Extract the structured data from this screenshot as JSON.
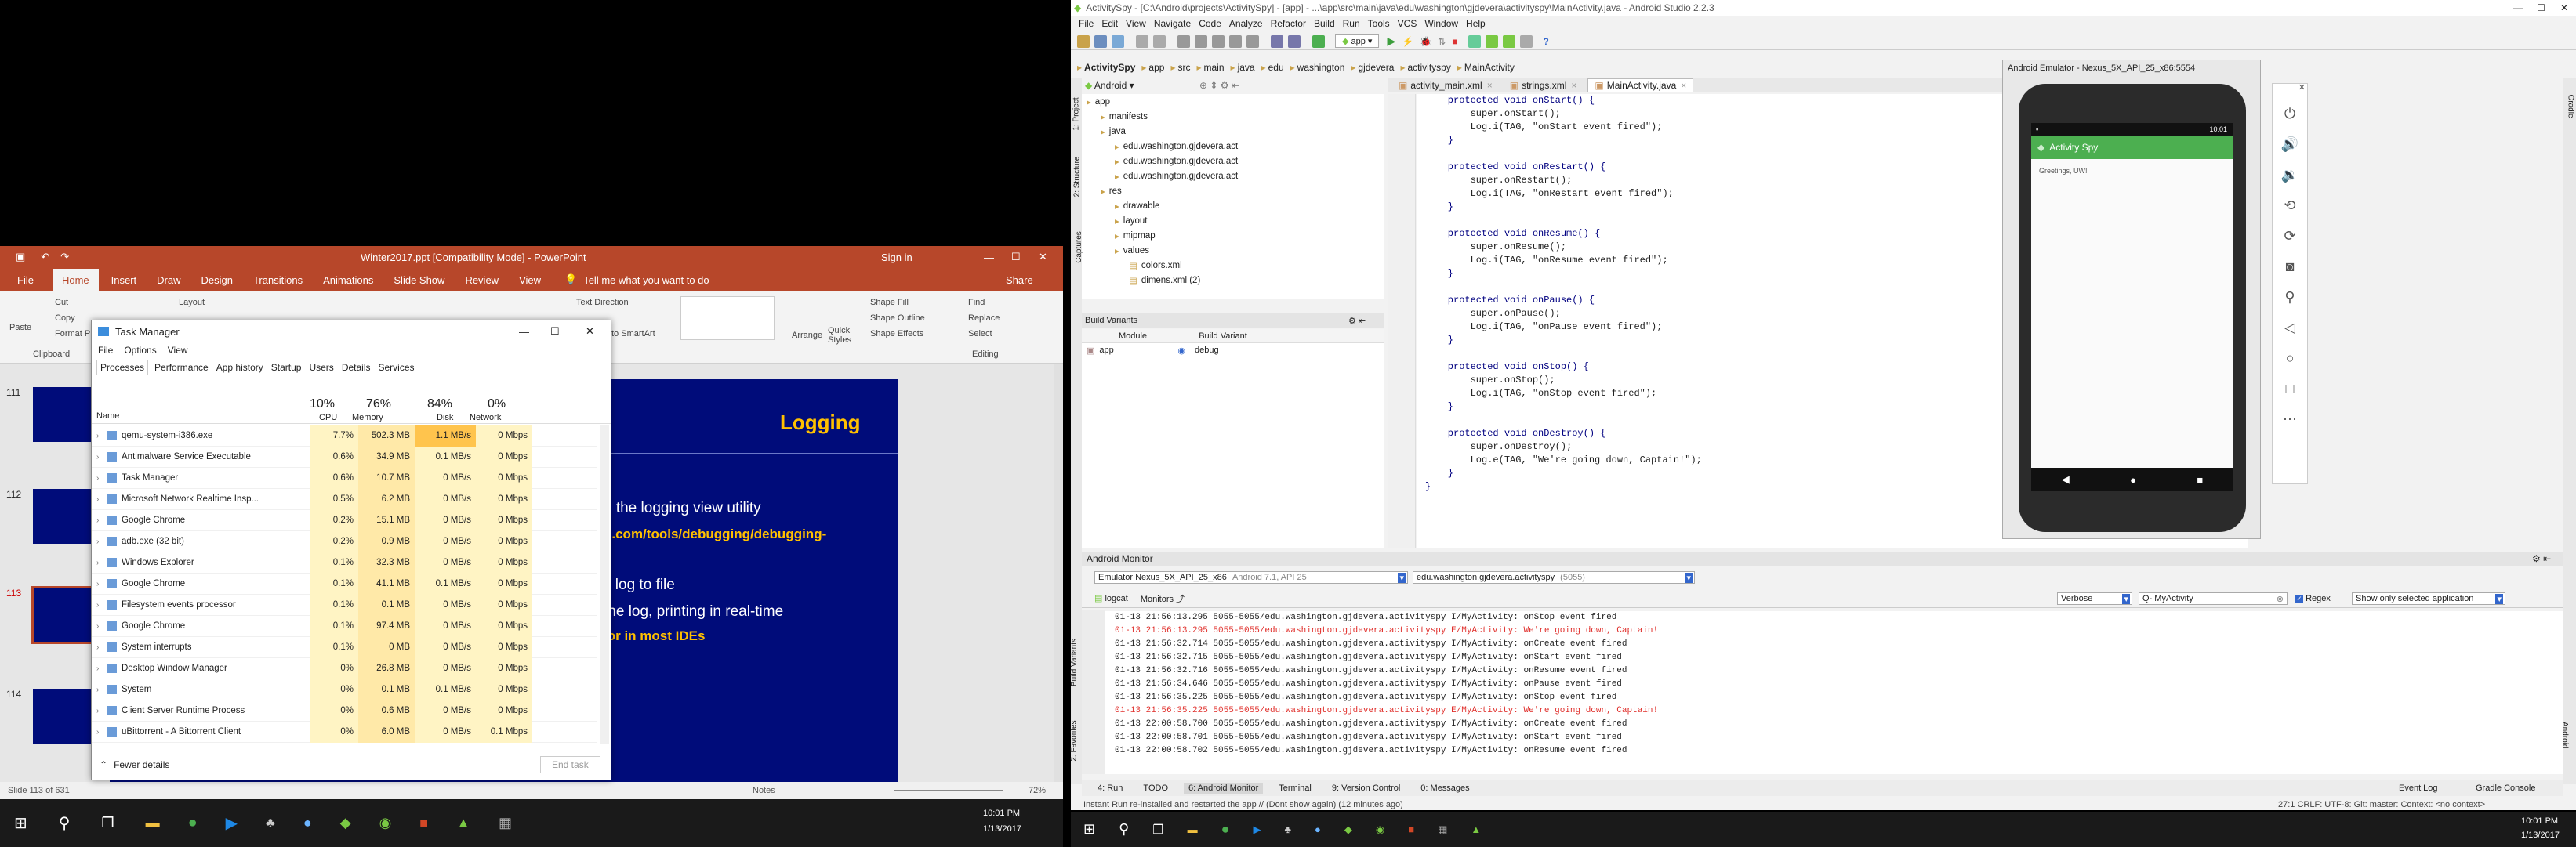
{
  "ppt": {
    "title": "Winter2017.ppt [Compatibility Mode]  -  PowerPoint",
    "signin": "Sign in",
    "tabs": [
      "File",
      "Home",
      "Insert",
      "Draw",
      "Design",
      "Transitions",
      "Animations",
      "Slide Show",
      "Review",
      "View"
    ],
    "tellme": "Tell me what you want to do",
    "share": "Share",
    "ribbon": {
      "paste": "Paste",
      "cut": "Cut",
      "copy": "Copy",
      "format": "Format P",
      "clipboard": "Clipboard",
      "layout": "Layout",
      "text_direction": "Text Direction",
      "smartart": "to SmartArt",
      "arrange": "Arrange",
      "quick_styles": "Quick Styles",
      "shape_fill": "Shape Fill",
      "shape_outline": "Shape Outline",
      "shape_effects": "Shape Effects",
      "find": "Find",
      "replace": "Replace",
      "select": "Select",
      "editing": "Editing"
    },
    "thumb_numbers": [
      "111",
      "112",
      "113",
      "114"
    ],
    "slide": {
      "title": "Logging",
      "lines": [
        "t, the logging view utility",
        "d.com/tools/debugging/debugging-",
        "s log to file",
        "the log, printing in real-time",
        "ior in most IDEs"
      ]
    },
    "status": {
      "slide": "Slide 113 of 631",
      "notes": "Notes",
      "zoom": "72%"
    }
  },
  "taskmgr": {
    "title": "Task Manager",
    "menu": [
      "File",
      "Options",
      "View"
    ],
    "tabs": [
      "Processes",
      "Performance",
      "App history",
      "Startup",
      "Users",
      "Details",
      "Services"
    ],
    "headers": {
      "name": "Name",
      "cpu_pct": "10%",
      "cpu": "CPU",
      "mem_pct": "76%",
      "mem": "Memory",
      "disk_pct": "84%",
      "disk": "Disk",
      "net_pct": "0%",
      "net": "Network"
    },
    "rows": [
      {
        "name": "qemu-system-i386.exe",
        "cpu": "7.7%",
        "mem": "502.3 MB",
        "disk": "1.1 MB/s",
        "net": "0 Mbps"
      },
      {
        "name": "Antimalware Service Executable",
        "cpu": "0.6%",
        "mem": "34.9 MB",
        "disk": "0.1 MB/s",
        "net": "0 Mbps"
      },
      {
        "name": "Task Manager",
        "cpu": "0.6%",
        "mem": "10.7 MB",
        "disk": "0 MB/s",
        "net": "0 Mbps"
      },
      {
        "name": "Microsoft Network Realtime Insp...",
        "cpu": "0.5%",
        "mem": "6.2 MB",
        "disk": "0 MB/s",
        "net": "0 Mbps"
      },
      {
        "name": "Google Chrome",
        "cpu": "0.2%",
        "mem": "15.1 MB",
        "disk": "0 MB/s",
        "net": "0 Mbps"
      },
      {
        "name": "adb.exe (32 bit)",
        "cpu": "0.2%",
        "mem": "0.9 MB",
        "disk": "0 MB/s",
        "net": "0 Mbps"
      },
      {
        "name": "Windows Explorer",
        "cpu": "0.1%",
        "mem": "32.3 MB",
        "disk": "0 MB/s",
        "net": "0 Mbps"
      },
      {
        "name": "Google Chrome",
        "cpu": "0.1%",
        "mem": "41.1 MB",
        "disk": "0.1 MB/s",
        "net": "0 Mbps"
      },
      {
        "name": "Filesystem events processor",
        "cpu": "0.1%",
        "mem": "0.1 MB",
        "disk": "0 MB/s",
        "net": "0 Mbps"
      },
      {
        "name": "Google Chrome",
        "cpu": "0.1%",
        "mem": "97.4 MB",
        "disk": "0 MB/s",
        "net": "0 Mbps"
      },
      {
        "name": "System interrupts",
        "cpu": "0.1%",
        "mem": "0 MB",
        "disk": "0 MB/s",
        "net": "0 Mbps"
      },
      {
        "name": "Desktop Window Manager",
        "cpu": "0%",
        "mem": "26.8 MB",
        "disk": "0 MB/s",
        "net": "0 Mbps"
      },
      {
        "name": "System",
        "cpu": "0%",
        "mem": "0.1 MB",
        "disk": "0.1 MB/s",
        "net": "0 Mbps"
      },
      {
        "name": "Client Server Runtime Process",
        "cpu": "0%",
        "mem": "0.6 MB",
        "disk": "0 MB/s",
        "net": "0 Mbps"
      },
      {
        "name": "uBittorrent - A Bittorrent Client",
        "cpu": "0%",
        "mem": "6.0 MB",
        "disk": "0 MB/s",
        "net": "0.1 Mbps"
      }
    ],
    "fewer": "Fewer details",
    "end_task": "End task"
  },
  "studio": {
    "title": "ActivitySpy - [C:\\Android\\projects\\ActivitySpy] - [app] - ...\\app\\src\\main\\java\\edu\\washington\\gjdevera\\activityspy\\MainActivity.java - Android Studio 2.2.3",
    "menu": [
      "File",
      "Edit",
      "View",
      "Navigate",
      "Code",
      "Analyze",
      "Refactor",
      "Build",
      "Run",
      "Tools",
      "VCS",
      "Window",
      "Help"
    ],
    "run_config": "app",
    "breadcrumb": [
      "ActivitySpy",
      "app",
      "src",
      "main",
      "java",
      "edu",
      "washington",
      "gjdevera",
      "activityspy",
      "MainActivity"
    ],
    "project_view": "Android",
    "editor_tabs": [
      "activity_main.xml",
      "strings.xml",
      "MainActivity.java"
    ],
    "tree": [
      {
        "label": "app",
        "d": 0
      },
      {
        "label": "manifests",
        "d": 1
      },
      {
        "label": "java",
        "d": 1
      },
      {
        "label": "edu.washington.gjdevera.act",
        "d": 2
      },
      {
        "label": "edu.washington.gjdevera.act",
        "d": 2
      },
      {
        "label": "edu.washington.gjdevera.act",
        "d": 2
      },
      {
        "label": "res",
        "d": 1
      },
      {
        "label": "drawable",
        "d": 2
      },
      {
        "label": "layout",
        "d": 2
      },
      {
        "label": "mipmap",
        "d": 2
      },
      {
        "label": "values",
        "d": 2
      },
      {
        "label": "colors.xml",
        "d": 3
      },
      {
        "label": "dimens.xml (2)",
        "d": 3
      }
    ],
    "build_variants": {
      "title": "Build Variants",
      "module_h": "Module",
      "variant_h": "Build Variant",
      "module": "app",
      "variant": "debug"
    },
    "code": [
      "    protected void onStart() {",
      "        super.onStart();",
      "        Log.i(TAG, \"onStart event fired\");",
      "    }",
      "",
      "    protected void onRestart() {",
      "        super.onRestart();",
      "        Log.i(TAG, \"onRestart event fired\");",
      "    }",
      "",
      "    protected void onResume() {",
      "        super.onResume();",
      "        Log.i(TAG, \"onResume event fired\");",
      "    }",
      "",
      "    protected void onPause() {",
      "        super.onPause();",
      "        Log.i(TAG, \"onPause event fired\");",
      "    }",
      "",
      "    protected void onStop() {",
      "        super.onStop();",
      "        Log.i(TAG, \"onStop event fired\");",
      "    }",
      "",
      "    protected void onDestroy() {",
      "        super.onDestroy();",
      "        Log.e(TAG, \"We're going down, Captain!\");",
      "    }",
      "}"
    ],
    "side_left": [
      "1: Project",
      "2: Structure",
      "Captures",
      "Build Variants",
      "2: Favorites"
    ],
    "side_right": [
      "Gradle",
      "Android Model"
    ],
    "monitor": {
      "title": "Android Monitor",
      "device": "Emulator Nexus_5X_API_25_x86",
      "device_sub": "Android 7.1, API 25",
      "process": "edu.washington.gjdevera.activityspy",
      "pid": "(5055)",
      "tab_logcat": "logcat",
      "tab_monitors": "Monitors",
      "level": "Verbose",
      "filter": "Q- MyActivity",
      "regex": "Regex",
      "show_only": "Show only selected application",
      "log": [
        {
          "t": "01-13 21:56:13.295 5055-5055/edu.washington.gjdevera.activityspy I/MyActivity: onStop event fired",
          "err": false
        },
        {
          "t": "01-13 21:56:13.295 5055-5055/edu.washington.gjdevera.activityspy E/MyActivity: We're going down, Captain!",
          "err": true
        },
        {
          "t": "01-13 21:56:32.714 5055-5055/edu.washington.gjdevera.activityspy I/MyActivity: onCreate event fired",
          "err": false
        },
        {
          "t": "01-13 21:56:32.715 5055-5055/edu.washington.gjdevera.activityspy I/MyActivity: onStart event fired",
          "err": false
        },
        {
          "t": "01-13 21:56:32.716 5055-5055/edu.washington.gjdevera.activityspy I/MyActivity: onResume event fired",
          "err": false
        },
        {
          "t": "01-13 21:56:34.646 5055-5055/edu.washington.gjdevera.activityspy I/MyActivity: onPause event fired",
          "err": false
        },
        {
          "t": "01-13 21:56:35.225 5055-5055/edu.washington.gjdevera.activityspy I/MyActivity: onStop event fired",
          "err": false
        },
        {
          "t": "01-13 21:56:35.225 5055-5055/edu.washington.gjdevera.activityspy E/MyActivity: We're going down, Captain!",
          "err": true
        },
        {
          "t": "01-13 22:00:58.700 5055-5055/edu.washington.gjdevera.activityspy I/MyActivity: onCreate event fired",
          "err": false
        },
        {
          "t": "01-13 22:00:58.701 5055-5055/edu.washington.gjdevera.activityspy I/MyActivity: onStart event fired",
          "err": false
        },
        {
          "t": "01-13 22:00:58.702 5055-5055/edu.washington.gjdevera.activityspy I/MyActivity: onResume event fired",
          "err": false
        }
      ]
    },
    "bottom_tabs": [
      "4: Run",
      "TODO",
      "6: Android Monitor",
      "Terminal",
      "9: Version Control",
      "0: Messages"
    ],
    "event_log": "Event Log",
    "gradle_console": "Gradle Console",
    "status": "Instant Run re-installed and restarted the app // (Dont show again) (12 minutes ago)",
    "status_right": "27:1  CRLF:  UTF-8:  Git: master:  Context: <no context>"
  },
  "emulator": {
    "title": "Android Emulator - Nexus_5X_API_25_x86:5554",
    "clock": "10:01",
    "app_title": "Activity Spy",
    "greeting": "Greetings, UW!"
  },
  "taskbar": {
    "left_time": "10:01 PM",
    "left_date": "1/13/2017",
    "right_time": "10:01 PM",
    "right_date": "1/13/2017"
  },
  "colors": {
    "ppt_red": "#b7472a",
    "slide_blue": "#000c7a",
    "slide_gold": "#ffc000",
    "err": "#e0302c"
  }
}
